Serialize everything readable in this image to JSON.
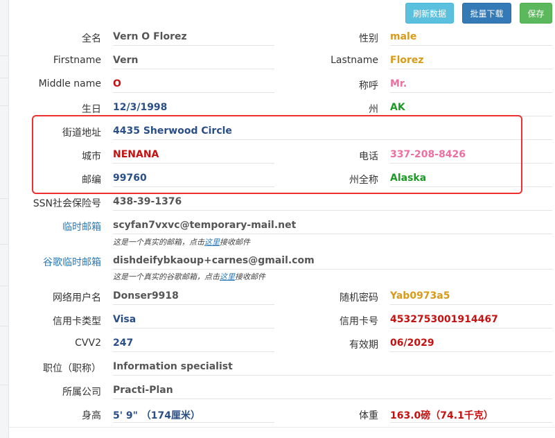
{
  "toolbar": {
    "refresh_label": "刷新数据",
    "download_label": "批量下载",
    "save_label": "保存"
  },
  "fields": {
    "full_name": {
      "label": "全名",
      "value": "Vern O Florez"
    },
    "gender": {
      "label": "性别",
      "value": "male"
    },
    "first_name": {
      "label": "Firstname",
      "value": "Vern"
    },
    "last_name": {
      "label": "Lastname",
      "value": "Florez"
    },
    "middle_name": {
      "label": "Middle name",
      "value": "O"
    },
    "title": {
      "label": "称呼",
      "value": "Mr."
    },
    "birthday": {
      "label": "生日",
      "value": "12/3/1998"
    },
    "state": {
      "label": "州",
      "value": "AK"
    },
    "street": {
      "label": "街道地址",
      "value": "4435 Sherwood Circle"
    },
    "city": {
      "label": "城市",
      "value": "NENANA"
    },
    "phone": {
      "label": "电话",
      "value": "337-208-8426"
    },
    "zip": {
      "label": "邮编",
      "value": "99760"
    },
    "state_full": {
      "label": "州全称",
      "value": "Alaska"
    },
    "ssn": {
      "label": "SSN社会保险号",
      "value": "438-39-1376"
    },
    "temp_email": {
      "label": "临时邮箱",
      "value": "scyfan7vxvc@temporary-mail.net",
      "note_prefix": "这是一个真实的邮箱，点击",
      "note_link": "这里",
      "note_suffix": "接收邮件"
    },
    "google_email": {
      "label": "谷歌临时邮箱",
      "value": "dishdeifybkaoup+carnes@gmail.com",
      "note_prefix": "这是一个真实的谷歌邮箱，点击",
      "note_link": "这里",
      "note_suffix": "接收邮件"
    },
    "username": {
      "label": "网络用户名",
      "value": "Donser9918"
    },
    "password": {
      "label": "随机密码",
      "value": "Yab0973a5"
    },
    "card_type": {
      "label": "信用卡类型",
      "value": "Visa"
    },
    "card_number": {
      "label": "信用卡号",
      "value": "4532753001914467"
    },
    "cvv": {
      "label": "CVV2",
      "value": "247"
    },
    "expiry": {
      "label": "有效期",
      "value": "06/2029"
    },
    "job": {
      "label": "职位（职称）",
      "value": "Information specialist"
    },
    "company": {
      "label": "所属公司",
      "value": "Practi-Plan"
    },
    "height": {
      "label": "身高",
      "value": "5' 9\" （174厘米）"
    },
    "weight": {
      "label": "体重",
      "value": "163.0磅（74.1千克）"
    }
  },
  "colors": {
    "refresh_button": "#5bc0de",
    "download_button": "#337ab7",
    "save_button": "#5cb85c",
    "highlight_border": "#ee2f2f"
  }
}
